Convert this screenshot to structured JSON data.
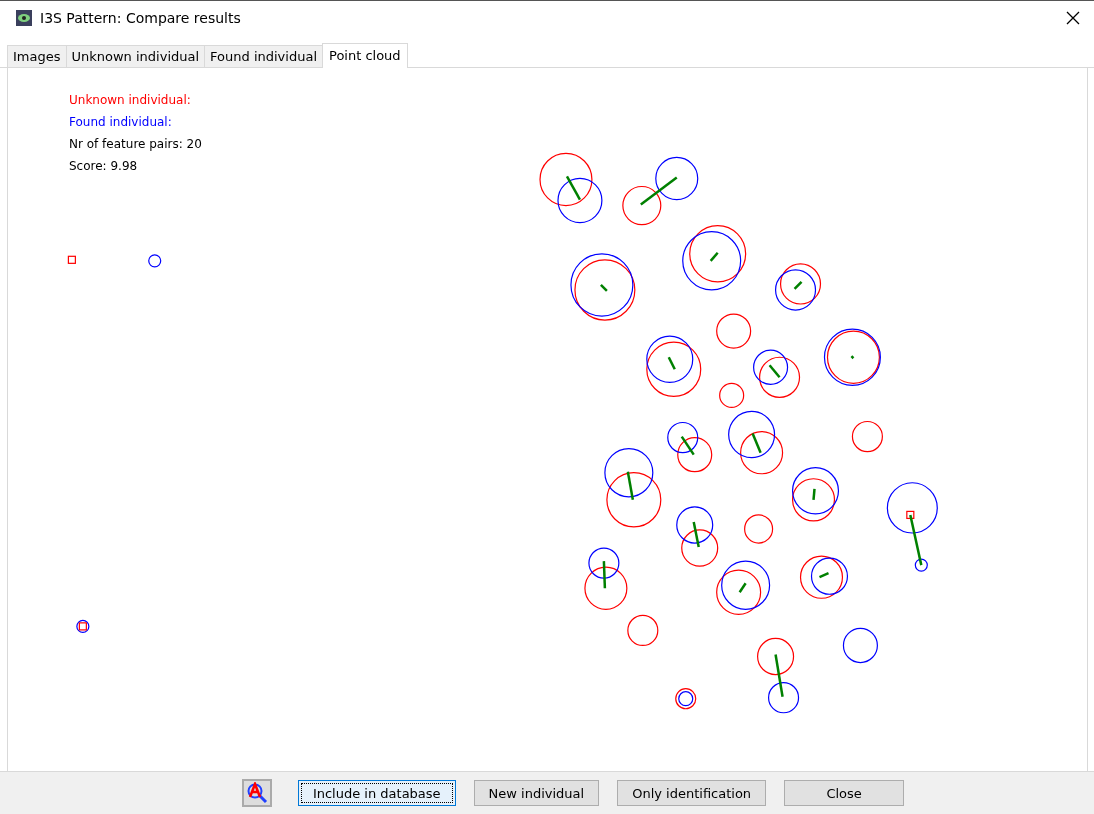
{
  "window": {
    "title": "I3S Pattern: Compare results"
  },
  "tabs": [
    {
      "label": "Images",
      "selected": false
    },
    {
      "label": "Unknown individual",
      "selected": false
    },
    {
      "label": "Found individual",
      "selected": false
    },
    {
      "label": "Point cloud",
      "selected": true
    }
  ],
  "info_lines": [
    {
      "text": "Unknown individual:",
      "color": "#ff0000"
    },
    {
      "text": "Found individual:",
      "color": "#0000ff"
    },
    {
      "text": "Nr of feature pairs: 20",
      "color": "#000000"
    },
    {
      "text": "Score: 9.98",
      "color": "#000000"
    }
  ],
  "buttons": [
    {
      "label": "Include in database",
      "focused": true
    },
    {
      "label": "New individual",
      "focused": false
    },
    {
      "label": "Only identification",
      "focused": false
    },
    {
      "label": "Close",
      "focused": false
    }
  ]
}
